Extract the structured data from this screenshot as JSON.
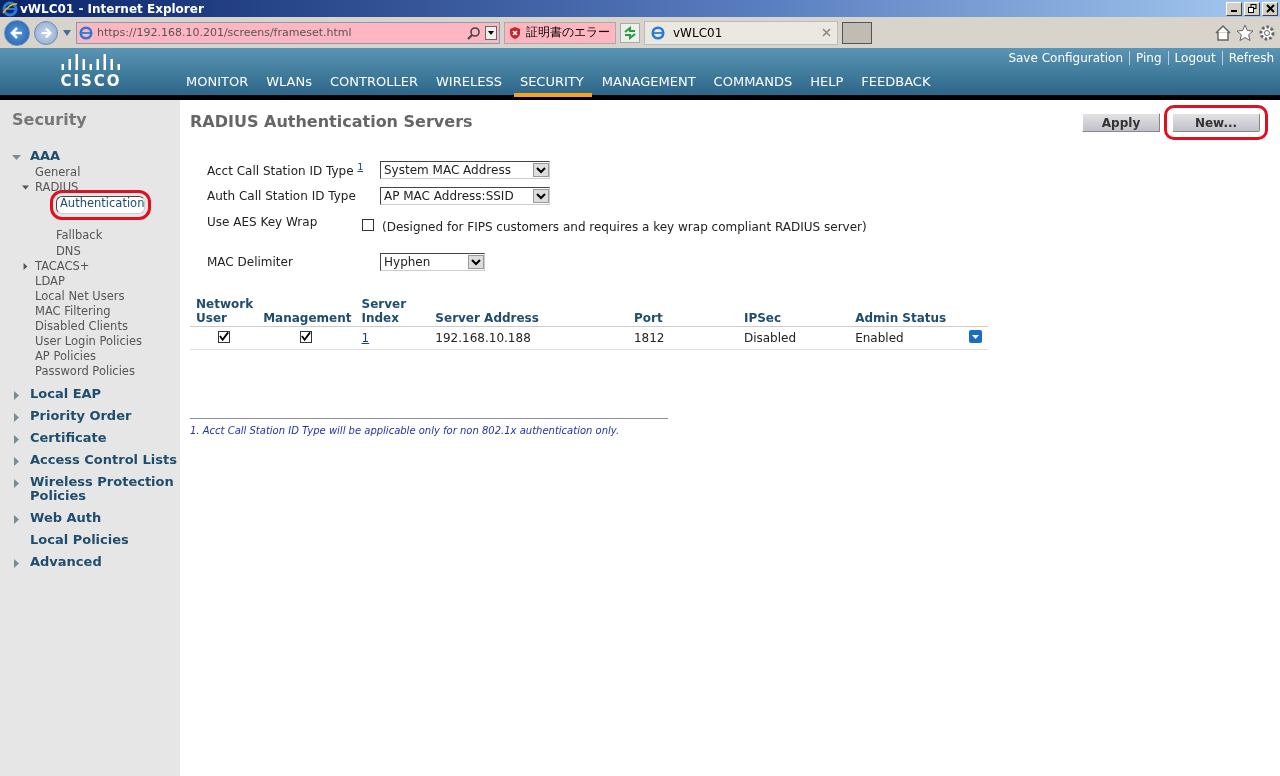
{
  "window": {
    "title": "vWLC01 - Internet Explorer"
  },
  "browser": {
    "url": "https://192.168.10.201/screens/frameset.html",
    "cert_error": "証明書のエラー",
    "tab": "vWLC01"
  },
  "header": {
    "logo_text": "CISCO"
  },
  "top_links": [
    "Save Configuration",
    "Ping",
    "Logout",
    "Refresh"
  ],
  "menu": [
    {
      "label": "MONITOR",
      "selected": false
    },
    {
      "label": "WLANs",
      "selected": false
    },
    {
      "label": "CONTROLLER",
      "selected": false
    },
    {
      "label": "WIRELESS",
      "selected": false
    },
    {
      "label": "SECURITY",
      "selected": true
    },
    {
      "label": "MANAGEMENT",
      "selected": false
    },
    {
      "label": "COMMANDS",
      "selected": false
    },
    {
      "label": "HELP",
      "selected": false
    },
    {
      "label": "FEEDBACK",
      "selected": false
    }
  ],
  "sidebar": {
    "title": "Security",
    "items": [
      {
        "label": "AAA",
        "expanded": true,
        "children": [
          {
            "label": "General"
          },
          {
            "label": "RADIUS",
            "expanded": true,
            "children": [
              {
                "label": "Authentication",
                "selected": true
              },
              {
                "label": "Fallback",
                "selected": false
              },
              {
                "label": "DNS",
                "selected": false
              }
            ]
          },
          {
            "label": "TACACS+",
            "expanded": false
          },
          {
            "label": "LDAP"
          },
          {
            "label": "Local Net Users"
          },
          {
            "label": "MAC Filtering"
          },
          {
            "label": "Disabled Clients"
          },
          {
            "label": "User Login Policies"
          },
          {
            "label": "AP Policies"
          },
          {
            "label": "Password Policies"
          }
        ]
      },
      {
        "label": "Local EAP",
        "expanded": false
      },
      {
        "label": "Priority Order",
        "expanded": false
      },
      {
        "label": "Certificate",
        "expanded": false
      },
      {
        "label": "Access Control Lists",
        "expanded": false
      },
      {
        "label": "Wireless Protection Policies",
        "expanded": false
      },
      {
        "label": "Web Auth",
        "expanded": false
      },
      {
        "label": "Local Policies"
      },
      {
        "label": "Advanced",
        "expanded": false
      }
    ]
  },
  "page": {
    "title": "RADIUS Authentication Servers",
    "buttons": [
      "Apply",
      "New..."
    ]
  },
  "form": {
    "acct_call_station": {
      "label": "Acct Call Station ID Type",
      "footnote": "1",
      "value": "System MAC Address"
    },
    "auth_call_station": {
      "label": "Auth Call Station ID Type",
      "value": "AP MAC Address:SSID"
    },
    "aes_key_wrap": {
      "label": "Use AES Key Wrap",
      "checked": false,
      "note": "(Designed for FIPS customers and requires a key wrap compliant RADIUS server)"
    },
    "mac_delimiter": {
      "label": "MAC Delimiter",
      "value": "Hyphen"
    }
  },
  "table": {
    "columns": [
      "Network User",
      "Management",
      "Server Index",
      "Server Address",
      "Port",
      "IPSec",
      "Admin Status"
    ],
    "rows": [
      {
        "network_user": true,
        "management": true,
        "index": "1",
        "address": "192.168.10.188",
        "port": "1812",
        "ipsec": "Disabled",
        "admin_status": "Enabled"
      }
    ]
  },
  "footnote": "1. Acct Call Station ID Type will be applicable only for non 802.1x authentication only."
}
